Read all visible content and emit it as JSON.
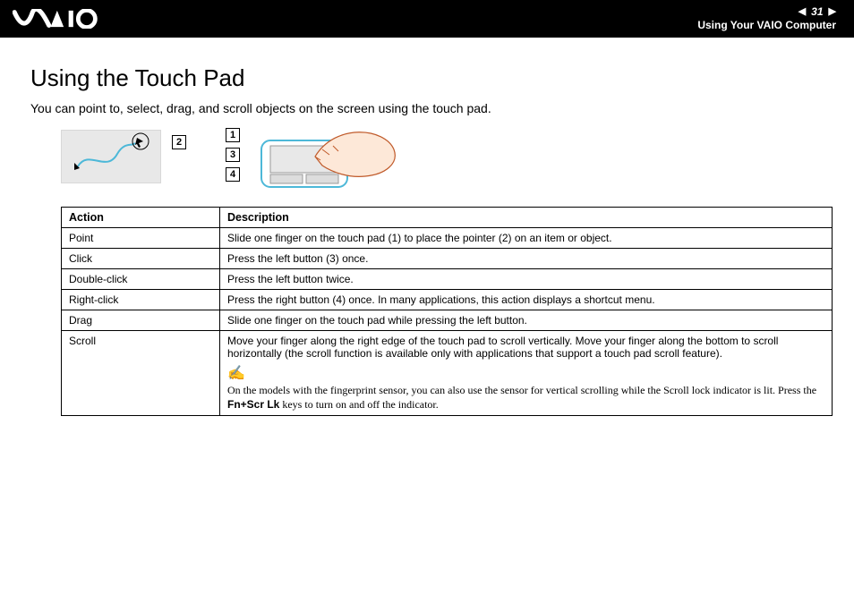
{
  "header": {
    "page_number": "31",
    "subtitle": "Using Your VAIO Computer"
  },
  "page": {
    "title": "Using the Touch Pad",
    "intro": "You can point to, select, drag, and scroll objects on the screen using the touch pad."
  },
  "callouts": {
    "c1": "1",
    "c2": "2",
    "c3": "3",
    "c4": "4"
  },
  "table": {
    "head_action": "Action",
    "head_desc": "Description",
    "rows": [
      {
        "action": "Point",
        "desc": "Slide one finger on the touch pad (1) to place the pointer (2) on an item or object."
      },
      {
        "action": "Click",
        "desc": "Press the left button (3) once."
      },
      {
        "action": "Double-click",
        "desc": "Press the left button twice."
      },
      {
        "action": "Right-click",
        "desc": "Press the right button (4) once. In many applications, this action displays a shortcut menu."
      },
      {
        "action": "Drag",
        "desc": "Slide one finger on the touch pad while pressing the left button."
      }
    ],
    "scroll": {
      "action": "Scroll",
      "desc": "Move your finger along the right edge of the touch pad to scroll vertically. Move your finger along the bottom to scroll horizontally (the scroll function is available only with applications that support a touch pad scroll feature).",
      "note_pre": "On the models with the fingerprint sensor, you can also use the sensor for vertical scrolling while the Scroll lock indicator is lit. Press the ",
      "note_bold": "Fn+Scr Lk",
      "note_post": " keys to turn on and off the indicator."
    }
  }
}
